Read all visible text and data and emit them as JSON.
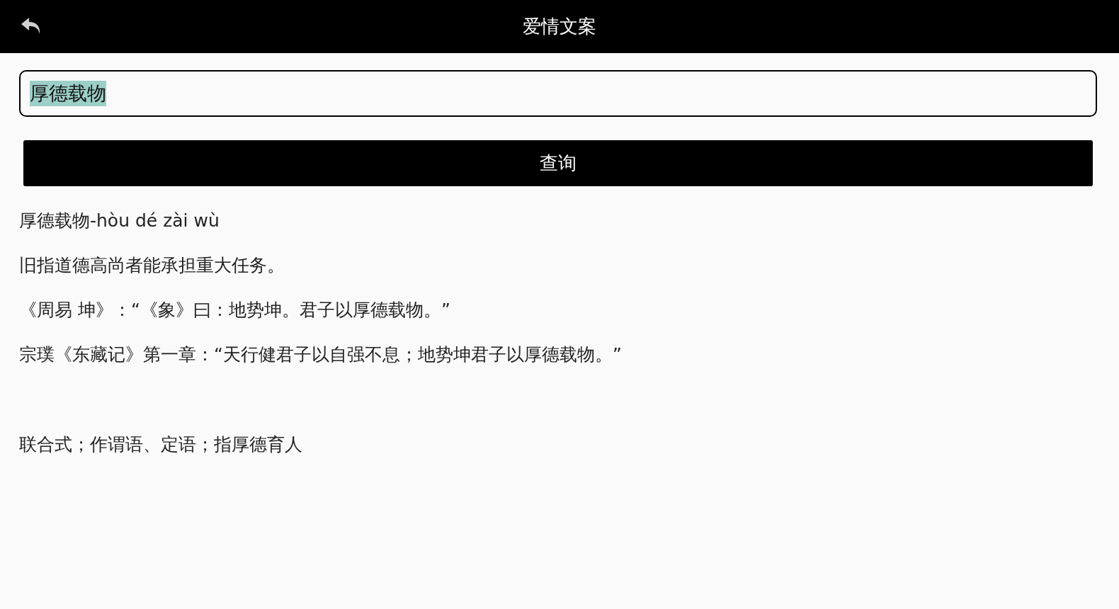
{
  "header": {
    "title": "爱情文案"
  },
  "search": {
    "value": "厚德载物",
    "value_selected": true
  },
  "query_button": {
    "label": "查询"
  },
  "result": [
    {
      "kind": "heading",
      "text": "厚德载物-hòu dé zài wù"
    },
    {
      "kind": "meaning",
      "text": "旧指道德高尚者能承担重大任务。"
    },
    {
      "kind": "source",
      "text": "《周易 坤》：“《象》曰：地势坤。君子以厚德载物。”"
    },
    {
      "kind": "example",
      "text": "宗璞《东藏记》第一章：“天行健君子以自强不息；地势坤君子以厚德载物。”"
    },
    {
      "kind": "usage",
      "text": "联合式；作谓语、定语；指厚德育人"
    }
  ]
}
